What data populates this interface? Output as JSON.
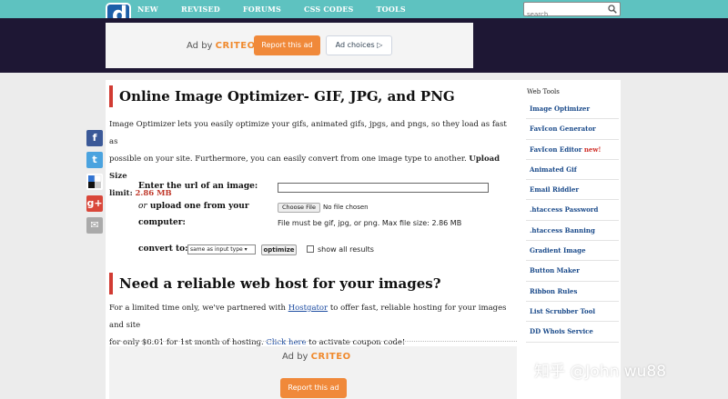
{
  "nav": {
    "logo_letter": "d",
    "items": [
      "NEW",
      "REVISED",
      "FORUMS",
      "CSS CODES",
      "TOOLS"
    ],
    "search_placeholder": "search"
  },
  "ad_top": {
    "ad_by": "Ad by",
    "brand": "CRITEO",
    "report": "Report this ad",
    "choices": "Ad choices ▷"
  },
  "main": {
    "title": "Online Image Optimizer- GIF, JPG, and PNG",
    "intro_1": "Image Optimizer lets you easily optimize your gifs, animated gifs, jpgs, and pngs, so they load as fast as",
    "intro_2": "possible on your site. Furthermore, you can easily convert from one image type to another.",
    "upload_label": "Upload Size",
    "limit_label": "limit:",
    "limit_value": "2.86 MB",
    "form": {
      "url_label": "Enter the url of an image:",
      "or": "or",
      "upload_label_1": "upload one from your",
      "upload_label_2": "computer:",
      "choose_file": "Choose File",
      "no_file": "No file chosen",
      "file_note": "File must be gif, jpg, or png. Max file size: 2.86 MB",
      "convert_label": "convert to:",
      "convert_value": "same as input type ▾",
      "optimize": "optimize",
      "show_all": "show all results"
    },
    "host_title": "Need a reliable web host for your images?",
    "host_1a": "For a limited time only, we've partnered with",
    "host_link": "Hostgator",
    "host_1b": "to offer fast, reliable hosting for your images and site",
    "host_2a": "for only $0.01 for 1st month of hosting.",
    "host_click": "Click here",
    "host_2b": "to activate coupon code!"
  },
  "ad_bottom": {
    "ad_by": "Ad by",
    "brand": "CRITEO",
    "report": "Report this ad"
  },
  "social": {
    "facebook": "f",
    "twitter": "t",
    "delicious": "",
    "google": "g+",
    "email": "✉"
  },
  "sidebar": {
    "title": "Web Tools",
    "items": [
      "Image Optimizer",
      "FavIcon Generator",
      "FavIcon Editor",
      "Animated Gif",
      "Email Riddler",
      ".htaccess Password",
      ".htaccess Banning",
      "Gradient Image",
      "Button Maker",
      "Ribbon Rules",
      "List Scrubber Tool",
      "DD Whois Service"
    ],
    "new_badge": "new!"
  },
  "watermark": "知乎 @John wu88"
}
